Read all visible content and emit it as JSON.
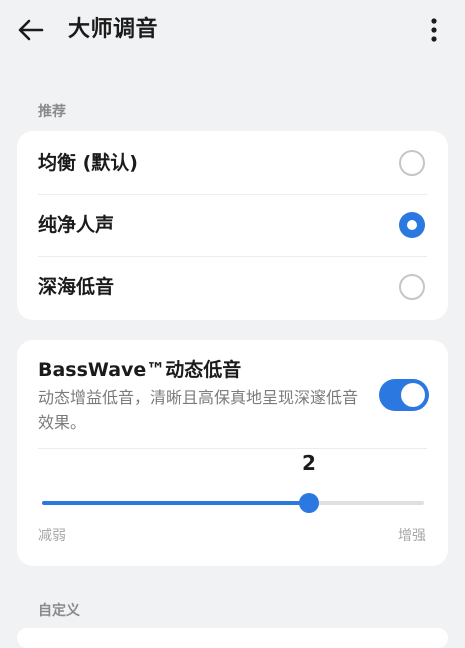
{
  "header": {
    "title": "大师调音",
    "back_icon": "arrow-left-icon",
    "more_icon": "more-vertical-icon"
  },
  "recommend": {
    "section_label": "推荐",
    "options": [
      {
        "label": "均衡 (默认)",
        "selected": false
      },
      {
        "label": "纯净人声",
        "selected": true
      },
      {
        "label": "深海低音",
        "selected": false
      }
    ]
  },
  "basswave": {
    "title": "BassWave™动态低音",
    "description": "动态增益低音，清晰且高保真地呈现深邃低音效果。",
    "enabled": true,
    "slider": {
      "value": "2",
      "level_fraction": 0.7,
      "min_label": "减弱",
      "max_label": "增强"
    }
  },
  "custom": {
    "section_label": "自定义"
  },
  "colors": {
    "accent": "#2b78e0",
    "background": "#f1f2f4",
    "card": "#ffffff"
  }
}
